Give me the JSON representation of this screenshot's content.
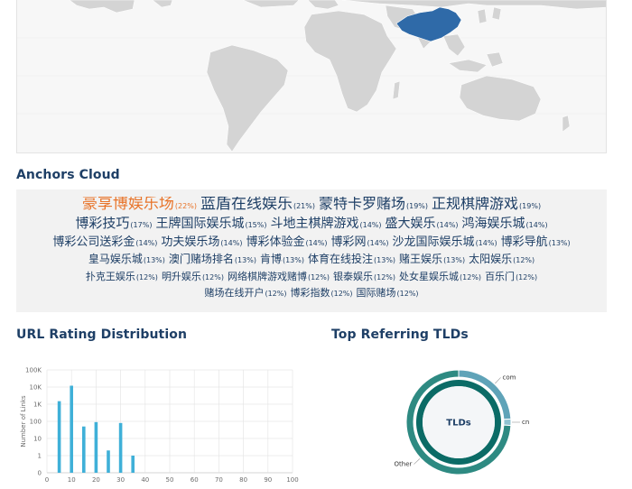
{
  "map": {
    "colors": {
      "land": "#d4d4d4",
      "highlight": "#2f6aa8",
      "background": "#f7f7f7"
    },
    "highlighted_country": "China"
  },
  "anchors": {
    "title": "Anchors Cloud",
    "rows": [
      [
        {
          "text": "豪享博娱乐场",
          "pct": "(22%)",
          "size": 17,
          "hot": true
        },
        {
          "text": "蓝盾在线娱乐",
          "pct": "(21%)",
          "size": 17
        },
        {
          "text": "蒙特卡罗赌场",
          "pct": "(19%)",
          "size": 16
        },
        {
          "text": "正规棋牌游戏",
          "pct": "(19%)",
          "size": 16
        }
      ],
      [
        {
          "text": "博彩技巧",
          "pct": "(17%)",
          "size": 15
        },
        {
          "text": "王牌国际娱乐城",
          "pct": "(15%)",
          "size": 14
        },
        {
          "text": "斗地主棋牌游戏",
          "pct": "(14%)",
          "size": 14
        },
        {
          "text": "盛大娱乐",
          "pct": "(14%)",
          "size": 14
        },
        {
          "text": "鸿海娱乐城",
          "pct": "(14%)",
          "size": 14
        }
      ],
      [
        {
          "text": "博彩公司送彩金",
          "pct": "(14%)",
          "size": 13
        },
        {
          "text": "功夫娱乐场",
          "pct": "(14%)",
          "size": 13
        },
        {
          "text": "博彩体验金",
          "pct": "(14%)",
          "size": 13
        },
        {
          "text": "博彩网",
          "pct": "(14%)",
          "size": 13
        },
        {
          "text": "沙龙国际娱乐城",
          "pct": "(14%)",
          "size": 13
        },
        {
          "text": "博彩导航",
          "pct": "(13%)",
          "size": 13
        }
      ],
      [
        {
          "text": "皇马娱乐城",
          "pct": "(13%)",
          "size": 12
        },
        {
          "text": "澳门赌场排名",
          "pct": "(13%)",
          "size": 12
        },
        {
          "text": "肯博",
          "pct": "(13%)",
          "size": 12
        },
        {
          "text": "体育在线投注",
          "pct": "(13%)",
          "size": 12
        },
        {
          "text": "赌王娱乐",
          "pct": "(13%)",
          "size": 12
        },
        {
          "text": "太阳娱乐",
          "pct": "(12%)",
          "size": 12
        }
      ],
      [
        {
          "text": "扑克王娱乐",
          "pct": "(12%)",
          "size": 11
        },
        {
          "text": "明升娱乐",
          "pct": "(12%)",
          "size": 11
        },
        {
          "text": "网络棋牌游戏赌博",
          "pct": "(12%)",
          "size": 11
        },
        {
          "text": "银泰娱乐",
          "pct": "(12%)",
          "size": 11
        },
        {
          "text": "处女星娱乐城",
          "pct": "(12%)",
          "size": 11
        },
        {
          "text": "百乐门",
          "pct": "(12%)",
          "size": 11
        }
      ],
      [
        {
          "text": "赌场在线开户",
          "pct": "(12%)",
          "size": 11
        },
        {
          "text": "博彩指数",
          "pct": "(12%)",
          "size": 11
        },
        {
          "text": "国际赌场",
          "pct": "(12%)",
          "size": 11
        }
      ]
    ]
  },
  "url_rating": {
    "title": "URL Rating Distribution",
    "chart_data": {
      "type": "bar",
      "ylabel": "Number of Links",
      "y_scale": "log",
      "y_ticks": [
        "0",
        "1",
        "10",
        "100",
        "1K",
        "10K",
        "100K"
      ],
      "x_ticks": [
        "0",
        "10",
        "20",
        "30",
        "40",
        "50",
        "60",
        "70",
        "80",
        "90",
        "100"
      ],
      "xlim": [
        0,
        100
      ],
      "bar_color": "#3fb0d8",
      "grid": true,
      "x": [
        5,
        10,
        15,
        20,
        25,
        30,
        35
      ],
      "values": [
        1500,
        12000,
        50,
        90,
        2,
        80,
        1
      ]
    }
  },
  "tlds": {
    "title": "Top Referring TLDs",
    "center_label": "TLDs",
    "chart_data": {
      "type": "pie",
      "labels": [
        "com",
        "cn",
        "Other"
      ],
      "values": [
        24,
        2,
        74
      ],
      "colors": [
        "#5fa3b8",
        "#8fc3d1",
        "#2e8a82"
      ],
      "inner_color": "#0b6b66"
    }
  }
}
